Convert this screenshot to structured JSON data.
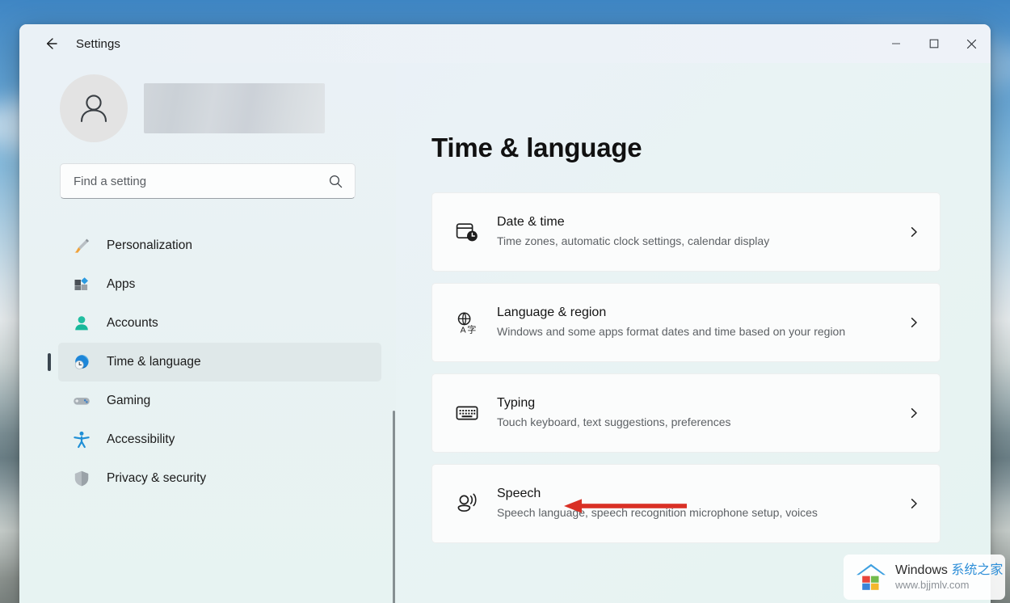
{
  "window": {
    "app_title": "Settings",
    "back_icon": "back-arrow-icon",
    "controls": {
      "minimize_label": "Minimize",
      "maximize_label": "Maximize",
      "close_label": "Close"
    }
  },
  "sidebar": {
    "account": {
      "avatar_icon": "person-avatar-icon",
      "name_redacted": ""
    },
    "search": {
      "placeholder": "Find a setting",
      "value": "",
      "icon": "search-icon"
    },
    "items": [
      {
        "label": "Personalization",
        "icon": "paintbrush-icon",
        "selected": false
      },
      {
        "label": "Apps",
        "icon": "apps-blocks-icon",
        "selected": false
      },
      {
        "label": "Accounts",
        "icon": "person-icon",
        "selected": false
      },
      {
        "label": "Time & language",
        "icon": "clock-globe-icon",
        "selected": true
      },
      {
        "label": "Gaming",
        "icon": "gamepad-icon",
        "selected": false
      },
      {
        "label": "Accessibility",
        "icon": "accessibility-person-icon",
        "selected": false
      },
      {
        "label": "Privacy & security",
        "icon": "shield-icon",
        "selected": false
      }
    ]
  },
  "main": {
    "page_title": "Time & language",
    "cards": [
      {
        "title": "Date & time",
        "description": "Time zones, automatic clock settings, calendar display",
        "icon": "calendar-clock-icon",
        "chevron": "chevron-right-icon"
      },
      {
        "title": "Language & region",
        "description": "Windows and some apps format dates and time based on your region",
        "icon": "globe-language-icon",
        "chevron": "chevron-right-icon"
      },
      {
        "title": "Typing",
        "description": "Touch keyboard, text suggestions, preferences",
        "icon": "keyboard-icon",
        "chevron": "chevron-right-icon"
      },
      {
        "title": "Speech",
        "description": "Speech language, speech recognition microphone setup, voices",
        "icon": "speech-person-icon",
        "chevron": "chevron-right-icon"
      }
    ]
  },
  "annotation": {
    "arrow_color": "#D93025",
    "points_to": "Speech"
  },
  "watermark": {
    "brand": "Windows ",
    "brand_cn": "系统之家",
    "url": "www.bjjmlv.com",
    "logo_icon": "windows-house-logo-icon"
  },
  "colors": {
    "accent_selected": "#3b4650",
    "window_bg": "#eef3f7",
    "sidebar_bg": "#e9f2f3",
    "card_bg": "#fbfcfc",
    "arrow_red": "#D93025"
  }
}
